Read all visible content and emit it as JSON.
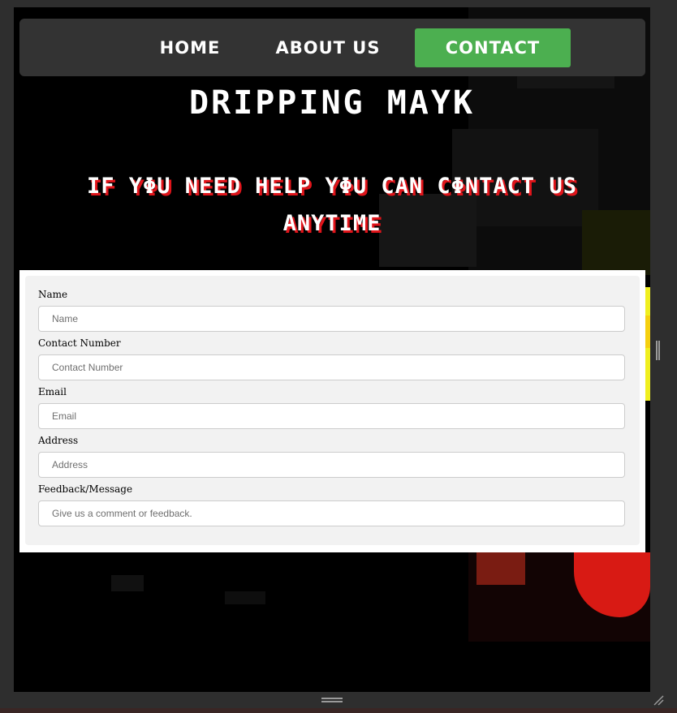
{
  "nav": {
    "home": "HOME",
    "about": "ABOUT US",
    "contact": "CONTACT"
  },
  "header": {
    "title": "DRIPPING MAYK",
    "tagline": "IF YΦU NEED HELP YΦU CAN CΦNTACT US ANYTIME"
  },
  "form": {
    "fields": [
      {
        "label": "Name",
        "placeholder": "Name"
      },
      {
        "label": "Contact Number",
        "placeholder": "Contact Number"
      },
      {
        "label": "Email",
        "placeholder": "Email"
      },
      {
        "label": "Address",
        "placeholder": "Address"
      },
      {
        "label": "Feedback/Message",
        "placeholder": "Give us a comment or feedback."
      }
    ]
  },
  "colors": {
    "accent": "#4caf50",
    "navbar": "#333333",
    "tagline_shadow": "#e0141a"
  }
}
